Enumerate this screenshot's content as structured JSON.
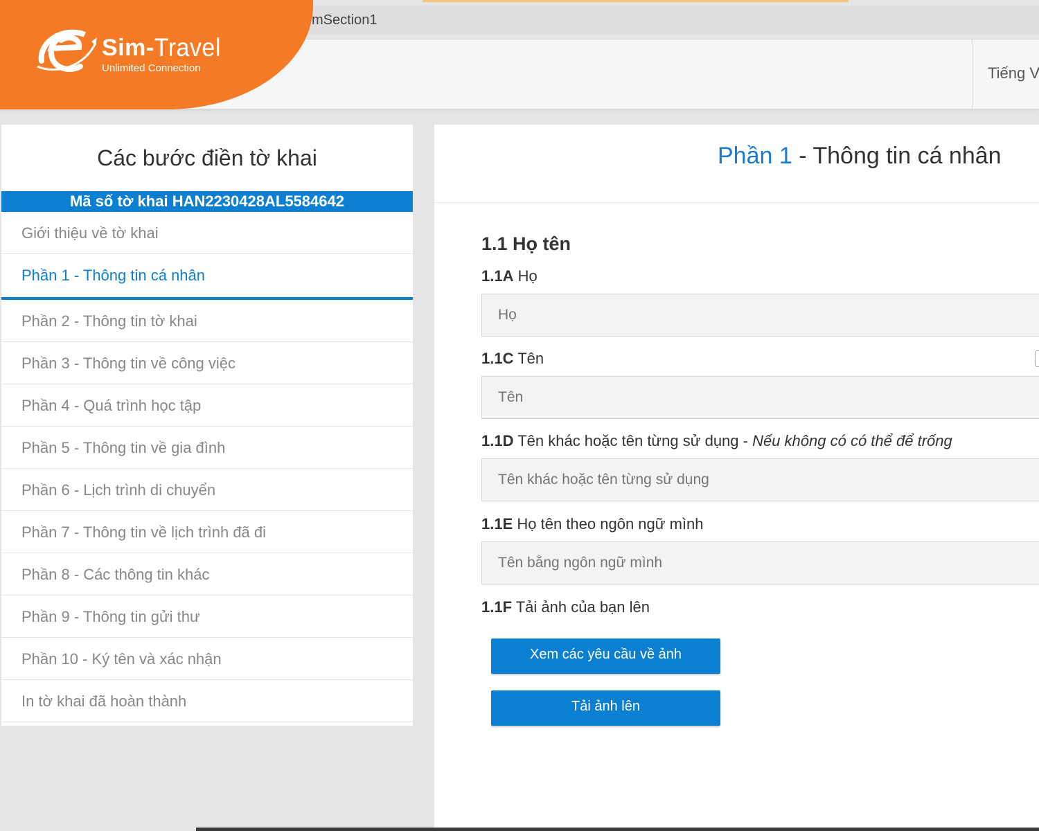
{
  "browser": {
    "url_fragment": "mSection1"
  },
  "header": {
    "logo_name_sim": "Sim",
    "logo_name_dash": "-",
    "logo_name_travel": "Travel",
    "logo_tagline": "Unlimited Connection",
    "language": "Tiếng V"
  },
  "sidebar": {
    "title": "Các bước điền tờ khai",
    "code": "Mã số tờ khai HAN2230428AL5584642",
    "steps": [
      {
        "label": "Giới thiệu về tờ khai"
      },
      {
        "label": "Phần 1 - Thông tin cá nhân"
      },
      {
        "label": "Phần 2 - Thông tin tờ khai"
      },
      {
        "label": "Phần 3 - Thông tin về công việc"
      },
      {
        "label": "Phần 4 - Quá trình học tập"
      },
      {
        "label": "Phần 5 - Thông tin về gia đình"
      },
      {
        "label": "Phần 6 - Lịch trình di chuyển"
      },
      {
        "label": "Phần 7 - Thông tin về lịch trình đã đi"
      },
      {
        "label": "Phần 8 - Các thông tin khác"
      },
      {
        "label": "Phần 9 - Thông tin gửi thư"
      },
      {
        "label": "Phần 10 - Ký tên và xác nhận"
      },
      {
        "label": "In tờ khai đã hoàn thành"
      }
    ]
  },
  "main": {
    "heading_part": "Phần 1",
    "heading_rest": " - Thông tin cá nhân",
    "section_title": "1.1 Họ tên",
    "fields": {
      "ho": {
        "code": "1.1A",
        "label": " Họ",
        "placeholder": "Họ",
        "value": ""
      },
      "ten": {
        "code": "1.1C",
        "label": " Tên",
        "placeholder": "Tên",
        "value": ""
      },
      "ten_khac": {
        "code": "1.1D",
        "label": " Tên khác hoặc tên từng sử dụng - ",
        "note": "Nếu không có có thể để trống",
        "placeholder": "Tên khác hoặc tên từng sử dụng",
        "value": ""
      },
      "ten_ngon_ngu": {
        "code": "1.1E",
        "label": " Họ tên theo ngôn ngữ mình",
        "placeholder": "Tên bằng ngôn ngữ mình",
        "value": ""
      },
      "anh": {
        "code": "1.1F",
        "label": " Tải ảnh của bạn lên"
      }
    },
    "buttons": {
      "photo_requirements": "Xem các yêu cầu về ảnh",
      "upload_photo": "Tải ảnh lên"
    }
  },
  "colors": {
    "brand_orange": "#f47a26",
    "accent_blue": "#0b7fd2"
  }
}
